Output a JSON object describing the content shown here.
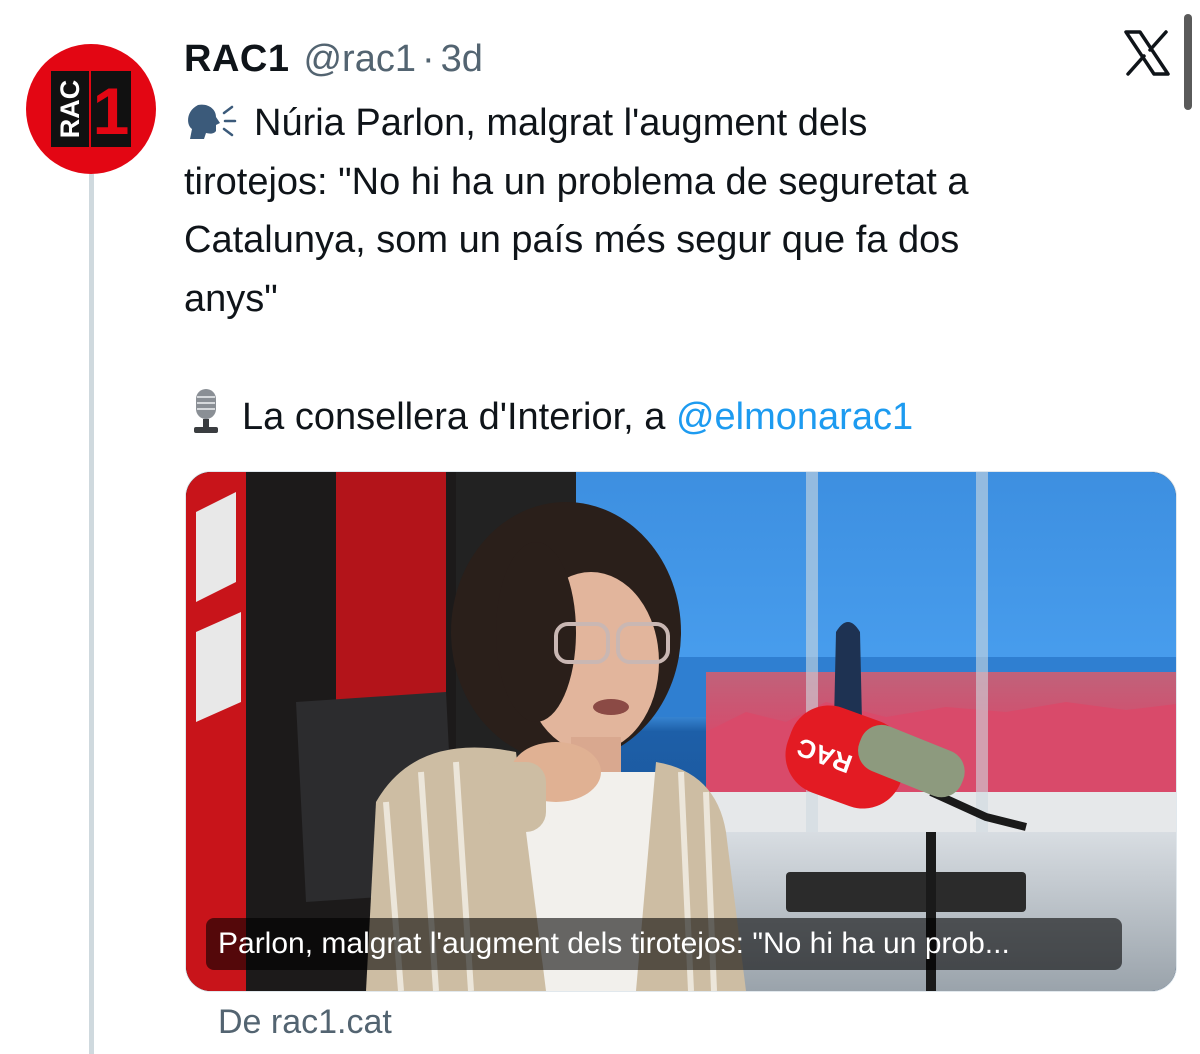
{
  "tweet": {
    "author_name": "RAC1",
    "author_handle": "@rac1",
    "separator": "·",
    "time": "3d",
    "avatar_text": "RAC",
    "avatar_number": "1",
    "avatar_icon": "rac1-logo-icon",
    "platform_icon": "x-logo-icon",
    "text_lines": [
      "Núria Parlon, malgrat l'augment dels",
      "tirotejos: \"No hi ha un problema de seguretat a",
      "Catalunya, som un país més segur que fa dos",
      "anys\""
    ],
    "speaking_emoji": "speaking-head-icon",
    "microphone_emoji": "studio-microphone-icon",
    "second_line_prefix": "La consellera d'Interior, a ",
    "mention": "@elmonarac1"
  },
  "card": {
    "caption": "Parlon, malgrat l'augment dels tirotejos: \"No hi ha un prob...",
    "source": "De rac1.cat",
    "mic_label": "RAC"
  },
  "colors": {
    "brand_red": "#e30613",
    "link_blue": "#1d9bf0",
    "secondary_text": "#536471",
    "thread_line": "#cfd9de"
  }
}
